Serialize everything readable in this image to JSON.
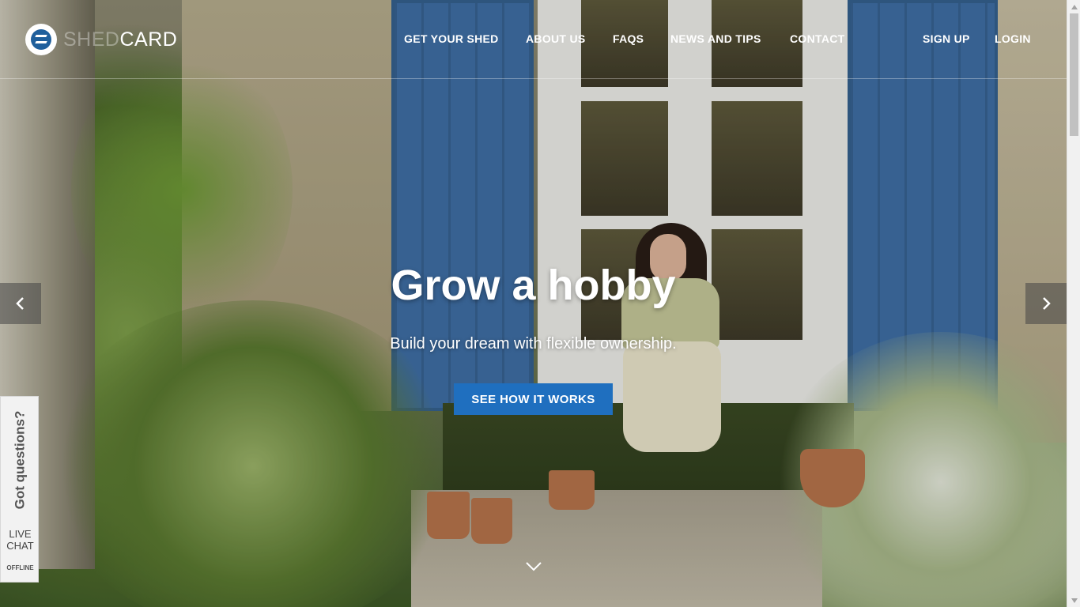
{
  "brand": {
    "logo_part1": "SHED",
    "logo_part2": "CARD"
  },
  "nav": {
    "links": [
      {
        "label": "GET YOUR SHED"
      },
      {
        "label": "ABOUT US"
      },
      {
        "label": "FAQS"
      },
      {
        "label": "NEWS AND TIPS"
      },
      {
        "label": "CONTACT"
      }
    ],
    "signup": "SIGN UP",
    "login": "LOGIN"
  },
  "hero": {
    "title": "Grow a hobby",
    "subtitle": "Build your dream with flexible ownership.",
    "cta": "SEE HOW IT WORKS"
  },
  "carousel": {
    "prev_icon": "chevron-left-icon",
    "next_icon": "chevron-right-icon",
    "scroll_icon": "chevron-down-icon"
  },
  "livechat": {
    "prompt": "Got questions?",
    "line1": "LIVE",
    "line2": "CHAT",
    "status": "OFFLINE"
  },
  "colors": {
    "accent": "#1f6fbf",
    "logo_blue": "#1f5f9c",
    "shutter_blue": "#3f6fa6"
  }
}
